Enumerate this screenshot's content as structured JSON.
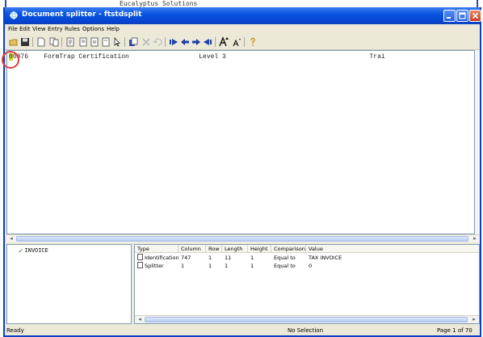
{
  "background_window": {
    "text": "Eucalyptus Solutions"
  },
  "window": {
    "title": "Document splitter - ftstdsplit"
  },
  "menu": [
    "File",
    "Edit",
    "View",
    "Entry",
    "Rules",
    "Options",
    "Help"
  ],
  "toolbar": {
    "icons": [
      "open-folder-icon",
      "save-icon",
      "new-document-icon",
      "copy-icon",
      "page-a-icon",
      "page-b-icon",
      "page-c-icon",
      "page-d-icon",
      "pointer-icon",
      "copy-page-icon",
      "delete-icon",
      "undo-icon",
      "first-page-icon",
      "previous-page-icon",
      "next-page-icon",
      "last-page-icon",
      "font-larger-icon",
      "font-smaller-icon",
      "help-icon"
    ]
  },
  "document": {
    "highlighted_prefix": "0",
    "line_rest": "0876    FormTrap Certification                  Level 3                                     Trai"
  },
  "rules_tree": {
    "items": [
      {
        "label": "INVOICE",
        "checked": true
      }
    ]
  },
  "rules_table": {
    "columns": [
      "Type",
      "Column",
      "Row",
      "Length",
      "Height",
      "Comparison",
      "Value"
    ],
    "rows": [
      [
        "Identification",
        "747",
        "1",
        "11",
        "1",
        "Equal to",
        "TAX INVOICE"
      ],
      [
        "Splitter",
        "1",
        "1",
        "1",
        "1",
        "Equal to",
        "0"
      ]
    ]
  },
  "status": {
    "left": "Ready",
    "middle": "No Selection",
    "right": "Page 1 of 70"
  },
  "colors": {
    "title_bar": "#0a55e0",
    "highlight": "#d7d72a",
    "annotation_circle": "#e23c3c"
  }
}
